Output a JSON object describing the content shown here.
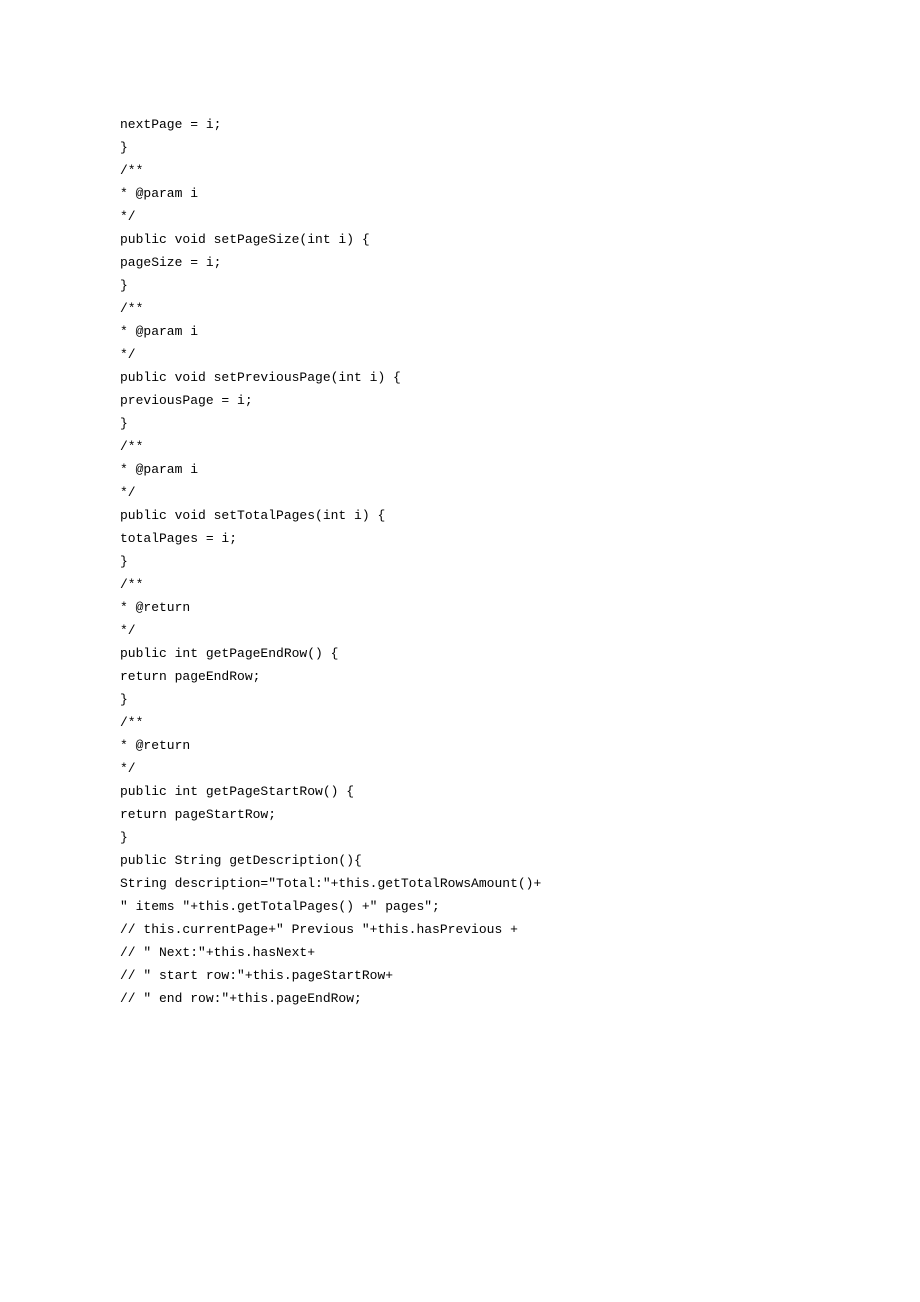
{
  "code": {
    "lines": [
      "nextPage = i;",
      "}",
      "",
      "/**",
      "* @param i",
      "*/",
      "public void setPageSize(int i) {",
      "pageSize = i;",
      "}",
      "",
      "/**",
      "* @param i",
      "*/",
      "public void setPreviousPage(int i) {",
      "previousPage = i;",
      "}",
      "",
      "/**",
      "* @param i",
      "*/",
      "public void setTotalPages(int i) {",
      "totalPages = i;",
      "}",
      "/**",
      "* @return",
      "*/",
      "public int getPageEndRow() {",
      "return pageEndRow;",
      "}",
      "",
      "/**",
      "* @return",
      "*/",
      "public int getPageStartRow() {",
      "return pageStartRow;",
      "}",
      "",
      "public String getDescription(){",
      "String description=\"Total:\"+this.getTotalRowsAmount()+",
      "\" items \"+this.getTotalPages() +\" pages\";",
      "// this.currentPage+\" Previous \"+this.hasPrevious +",
      "// \" Next:\"+this.hasNext+",
      "// \" start row:\"+this.pageStartRow+",
      "// \" end row:\"+this.pageEndRow;"
    ]
  }
}
